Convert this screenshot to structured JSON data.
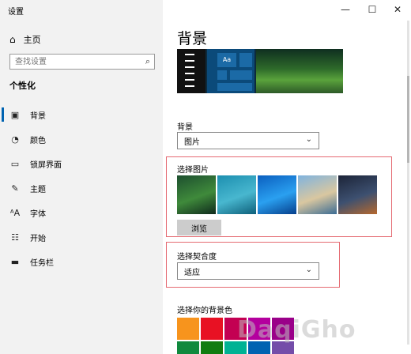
{
  "window": {
    "title": "设置",
    "minimize_glyph": "—",
    "maximize_glyph": "☐",
    "close_glyph": "✕"
  },
  "sidebar": {
    "home_label": "主页",
    "search_placeholder": "查找设置",
    "section_title": "个性化",
    "items": [
      {
        "label": "背景",
        "icon": "picture-icon",
        "glyph": "▣",
        "selected": true
      },
      {
        "label": "颜色",
        "icon": "palette-icon",
        "glyph": "◔",
        "selected": false
      },
      {
        "label": "锁屏界面",
        "icon": "lock-screen-icon",
        "glyph": "▭",
        "selected": false
      },
      {
        "label": "主题",
        "icon": "theme-icon",
        "glyph": "✎",
        "selected": false
      },
      {
        "label": "字体",
        "icon": "font-icon",
        "glyph": "ᴬA",
        "selected": false
      },
      {
        "label": "开始",
        "icon": "start-icon",
        "glyph": "☷",
        "selected": false
      },
      {
        "label": "任务栏",
        "icon": "taskbar-icon",
        "glyph": "▬",
        "selected": false
      }
    ]
  },
  "main": {
    "page_title": "背景",
    "preview": {
      "tile_text": "Aa"
    },
    "background_label": "背景",
    "background_value": "图片",
    "choose_picture_label": "选择图片",
    "browse_label": "浏览",
    "fit_label": "选择契合度",
    "fit_value": "适应",
    "bg_color_label": "选择你的背景色"
  },
  "thumbnails": [
    {
      "name": "lake-forest",
      "colors": [
        "#1d4f2f",
        "#3f8a3b",
        "#0f2a1c"
      ]
    },
    {
      "name": "underwater-swimmer",
      "colors": [
        "#1d8fb0",
        "#48b7cf",
        "#0e5f7a"
      ]
    },
    {
      "name": "windows-blue",
      "colors": [
        "#0b5fbf",
        "#2aa0f0",
        "#063f8c"
      ]
    },
    {
      "name": "beach-rocks",
      "colors": [
        "#7fb3df",
        "#d9c7a0",
        "#3b6c94"
      ]
    },
    {
      "name": "night-sky",
      "colors": [
        "#1c2438",
        "#3d5070",
        "#b5682e"
      ]
    }
  ],
  "accent_colors": [
    "#f7941d",
    "#e81123",
    "#c30052",
    "#b4009e",
    "#9a0089",
    "#10893e",
    "#107c10",
    "#00b294",
    "#0063b1",
    "#744da9"
  ],
  "watermark_text": "DaqiGho",
  "colors": {
    "accent": "#0063b1",
    "sidebar_bg": "#f2f2f2",
    "highlight": "#e56a72"
  }
}
